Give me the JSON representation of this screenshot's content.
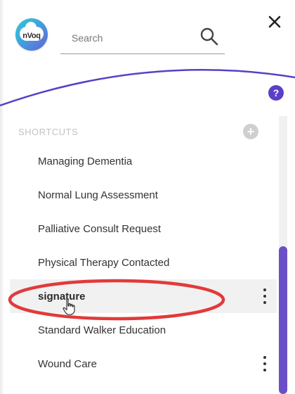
{
  "search": {
    "placeholder": "Search"
  },
  "logo": {
    "text": "nVoq"
  },
  "help": {
    "label": "?"
  },
  "shortcuts": {
    "section_label": "SHORTCUTS",
    "add_label": "+",
    "items": [
      {
        "label": "Managing Dementia",
        "has_menu": false,
        "hover": false
      },
      {
        "label": "Normal Lung Assessment",
        "has_menu": false,
        "hover": false
      },
      {
        "label": "Palliative Consult Request",
        "has_menu": false,
        "hover": false
      },
      {
        "label": "Physical Therapy Contacted",
        "has_menu": false,
        "hover": false
      },
      {
        "label": "signature",
        "has_menu": true,
        "hover": true
      },
      {
        "label": "Standard Walker Education",
        "has_menu": false,
        "hover": false
      },
      {
        "label": "Wound Care",
        "has_menu": true,
        "hover": false
      }
    ]
  },
  "colors": {
    "accent": "#5b3fc6",
    "arc": "#5b3fc6",
    "highlight": "#e23a3a",
    "scrollbar": "#6a4fc8"
  }
}
